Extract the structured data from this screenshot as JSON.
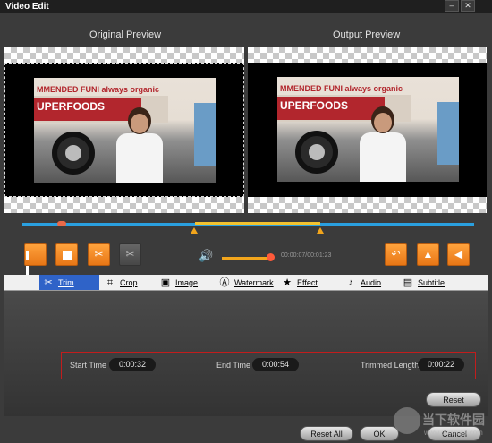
{
  "window": {
    "title": "Video Edit",
    "minimize": "–",
    "close": "✕"
  },
  "preview": {
    "original_label": "Original Preview",
    "output_label": "Output Preview",
    "frame_text_top": "MMENDED FUNI always organic",
    "frame_text_main": "UPERFOODS"
  },
  "playback": {
    "time": "00:00:07/00:01:23",
    "progress": 0.08,
    "trim_start_fraction": 0.38,
    "trim_end_fraction": 0.65,
    "volume_fraction": 0.9,
    "icons": [
      "pause-icon",
      "stop-icon",
      "scissors-icon",
      "scissors-disabled-icon",
      "rotate-icon",
      "flip-vertical-icon",
      "flip-horizontal-icon",
      "volume-icon"
    ]
  },
  "tabs": [
    {
      "label": "Trim",
      "icon": "scissors-icon",
      "active": true
    },
    {
      "label": "Crop",
      "icon": "crop-icon"
    },
    {
      "label": "Image",
      "icon": "image-icon"
    },
    {
      "label": "Watermark",
      "icon": "watermark-icon"
    },
    {
      "label": "Effect",
      "icon": "star-icon"
    },
    {
      "label": "Audio",
      "icon": "music-note-icon"
    },
    {
      "label": "Subtitle",
      "icon": "subtitle-icon"
    }
  ],
  "trim": {
    "start_label": "Start Time",
    "start_value": "0:00:32",
    "end_label": "End Time",
    "end_value": "0:00:54",
    "length_label": "Trimmed Length",
    "length_value": "0:00:22"
  },
  "buttons": {
    "reset": "Reset",
    "reset_all": "Reset All",
    "ok": "OK",
    "cancel": "Cancel"
  },
  "watermark": {
    "text": "当下软件园",
    "url": "www.downxia.com"
  },
  "colors": {
    "accent_orange": "#f2a51c",
    "timeline_blue": "#2aa0e0",
    "tab_active": "#2f63c8",
    "trim_border": "#c21d1d"
  }
}
